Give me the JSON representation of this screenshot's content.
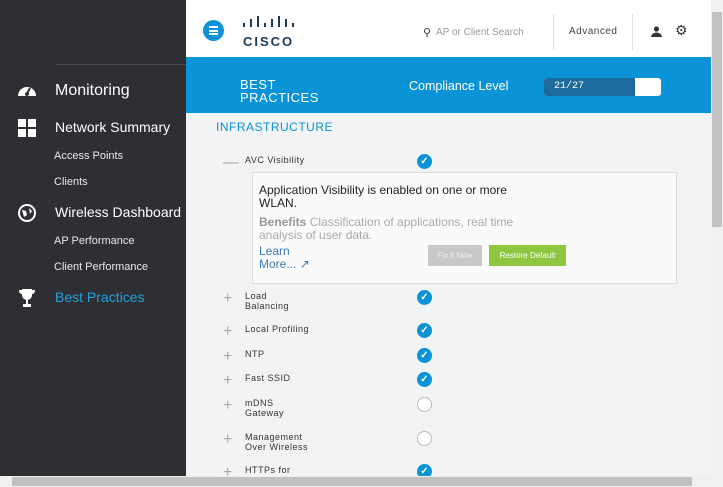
{
  "sidebar": {
    "items": [
      {
        "label": "Monitoring",
        "icon": "dashboard-icon"
      },
      {
        "label": "Network Summary",
        "icon": "grid-icon",
        "sub": [
          "Access Points",
          "Clients"
        ]
      },
      {
        "label": "Wireless Dashboard",
        "icon": "globe-icon",
        "sub": [
          "AP Performance",
          "Client Performance"
        ]
      },
      {
        "label": "Best Practices",
        "icon": "trophy-icon",
        "active": true
      }
    ]
  },
  "topbar": {
    "logo": "cisco",
    "search_placeholder": "AP or Client Search",
    "advanced": "Advanced"
  },
  "banner": {
    "title_line1": "BEST",
    "title_line2": "PRACTICES",
    "compliance_label": "Compliance Level",
    "compliance_value": "21/27",
    "compliance_fraction": 0.778
  },
  "section": "INFRASTRUCTURE",
  "expanded": {
    "name": "AVC Visibility",
    "message": "Application Visibility is enabled on one or more WLAN.",
    "benefits_label": "Benefits",
    "benefits_text": "Classification of applications, real time analysis of user data.",
    "learn_more": "Learn More...",
    "fix_button": "Fix it Now",
    "restore_button": "Restore Default"
  },
  "rows": [
    {
      "l1": "Load",
      "l2": "Balancing",
      "ok": true
    },
    {
      "l1": "Local Profiling",
      "l2": "",
      "ok": true
    },
    {
      "l1": "NTP",
      "l2": "",
      "ok": true
    },
    {
      "l1": "Fast SSID",
      "l2": "",
      "ok": true
    },
    {
      "l1": "mDNS",
      "l2": "Gateway",
      "ok": false
    },
    {
      "l1": "Management",
      "l2": "Over Wireless",
      "ok": false
    },
    {
      "l1": "HTTPs for",
      "l2": "",
      "ok": true
    }
  ],
  "colors": {
    "accent": "#0a93d6",
    "sidebar": "#2f2e33",
    "restore": "#8dc63f"
  }
}
